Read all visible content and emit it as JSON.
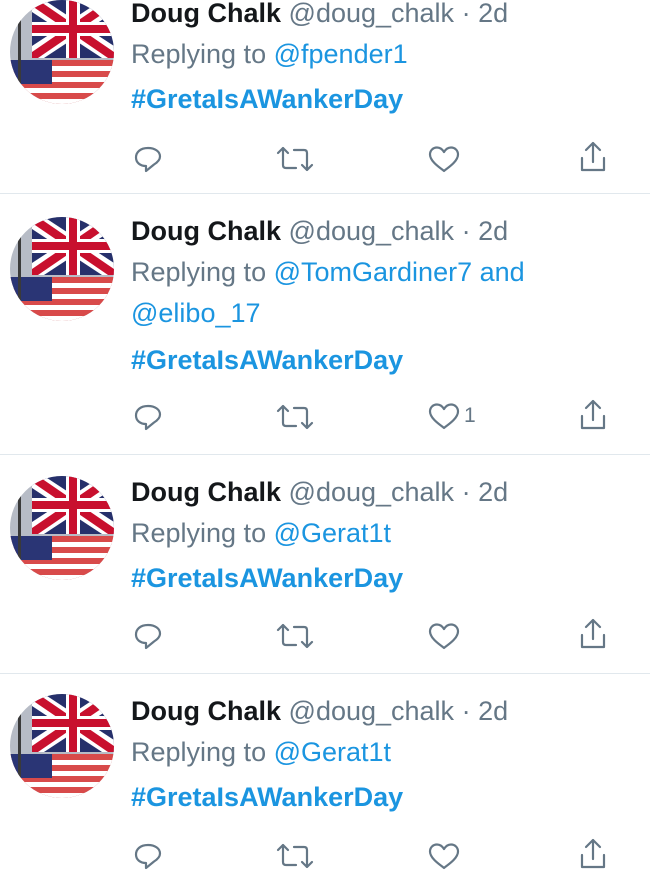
{
  "tweets": [
    {
      "name": "Doug Chalk",
      "handle": "@doug_chalk",
      "time": "2d",
      "replying_prefix": "Replying to",
      "reply_line1": "@fpender1",
      "reply_line2": "",
      "hashtag": "#GretaIsAWankerDay",
      "like_count": ""
    },
    {
      "name": "Doug Chalk",
      "handle": "@doug_chalk",
      "time": "2d",
      "replying_prefix": "Replying to",
      "reply_line1": "@TomGardiner7 and",
      "reply_line2": "@elibo_17",
      "hashtag": "#GretaIsAWankerDay",
      "like_count": "1"
    },
    {
      "name": "Doug Chalk",
      "handle": "@doug_chalk",
      "time": "2d",
      "replying_prefix": "Replying to",
      "reply_line1": "@Gerat1t",
      "reply_line2": "",
      "hashtag": "#GretaIsAWankerDay",
      "like_count": ""
    },
    {
      "name": "Doug Chalk",
      "handle": "@doug_chalk",
      "time": "2d",
      "replying_prefix": "Replying to",
      "reply_line1": "@Gerat1t",
      "reply_line2": "",
      "hashtag": "#GretaIsAWankerDay",
      "like_count": ""
    }
  ],
  "icons": {
    "reply": "reply-icon",
    "retweet": "retweet-icon",
    "like": "heart-icon",
    "share": "share-icon",
    "avatar": "avatar-union-jack-and-us-flag"
  },
  "colors": {
    "link": "#1b95e0",
    "text": "#14171a",
    "muted": "#657786",
    "divider": "#e1e8ed"
  }
}
